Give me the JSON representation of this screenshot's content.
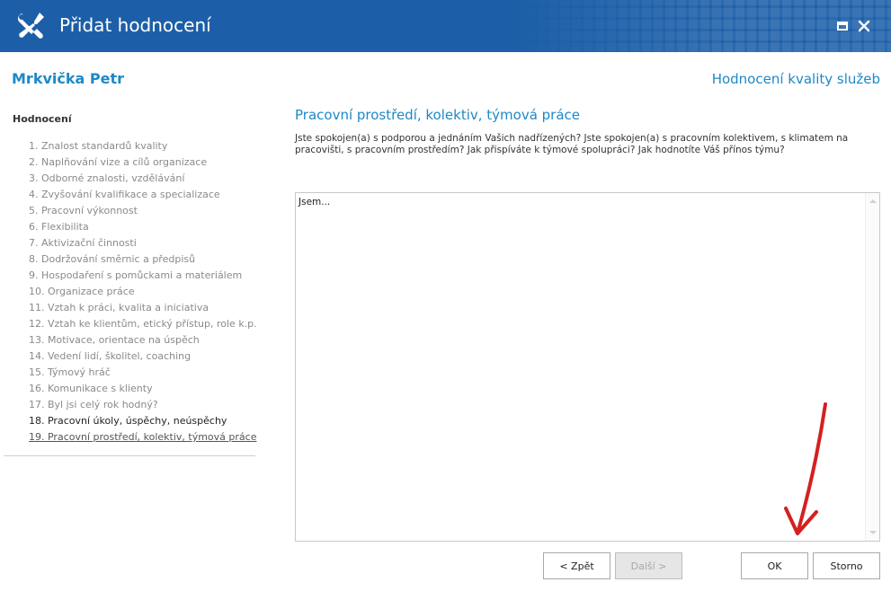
{
  "window": {
    "title": "Přidat hodnocení",
    "icon": "wrench-screwdriver-icon",
    "controls": [
      "maximize-icon",
      "close-icon"
    ],
    "accent_color": "#1c5fa8"
  },
  "header": {
    "person_name": "Mrkvička Petr",
    "section_name": "Hodnocení kvality služeb"
  },
  "sidebar": {
    "heading": "Hodnocení",
    "items": [
      {
        "label": "1. Znalost standardů kvality",
        "state": "pending"
      },
      {
        "label": "2. Naplňování vize a cílů organizace",
        "state": "pending"
      },
      {
        "label": "3. Odborné znalosti, vzdělávání",
        "state": "pending"
      },
      {
        "label": "4. Zvyšování kvalifikace a specializace",
        "state": "pending"
      },
      {
        "label": "5. Pracovní výkonnost",
        "state": "pending"
      },
      {
        "label": "6. Flexibilita",
        "state": "pending"
      },
      {
        "label": "7. Aktivizační činnosti",
        "state": "pending"
      },
      {
        "label": "8. Dodržování směrnic a předpisů",
        "state": "pending"
      },
      {
        "label": "9. Hospodaření s pomůckami a materiálem",
        "state": "pending"
      },
      {
        "label": "10. Organizace práce",
        "state": "pending"
      },
      {
        "label": "11. Vztah k práci, kvalita a iniciativa",
        "state": "pending"
      },
      {
        "label": "12. Vztah ke klientům, etický přístup, role k.p.",
        "state": "pending"
      },
      {
        "label": "13. Motivace, orientace na úspěch",
        "state": "pending"
      },
      {
        "label": "14. Vedení lidí, školitel, coaching",
        "state": "pending"
      },
      {
        "label": "15. Týmový hráč",
        "state": "pending"
      },
      {
        "label": "16. Komunikace s klienty",
        "state": "pending"
      },
      {
        "label": "17. Byl jsi celý rok hodný?",
        "state": "pending"
      },
      {
        "label": "18. Pracovní úkoly, úspěchy, neúspěchy",
        "state": "done"
      },
      {
        "label": "19. Pracovní prostředí, kolektiv, týmová práce",
        "state": "current"
      }
    ]
  },
  "main": {
    "question_title": "Pracovní prostředí, kolektiv, týmová práce",
    "question_text": "Jste spokojen(a) s podporou a jednáním Vašich nadřízených? Jste spokojen(a) s pracovním kolektivem, s klimatem na pracovišti, s pracovním prostředím? Jak přispíváte k týmové spolupráci? Jak hodnotíte Váš přínos týmu?",
    "answer_value": "Jsem..."
  },
  "buttons": {
    "back": "< Zpět",
    "next": "Další >",
    "ok": "OK",
    "cancel": "Storno"
  },
  "annotation": {
    "arrow_color": "#d42020"
  }
}
